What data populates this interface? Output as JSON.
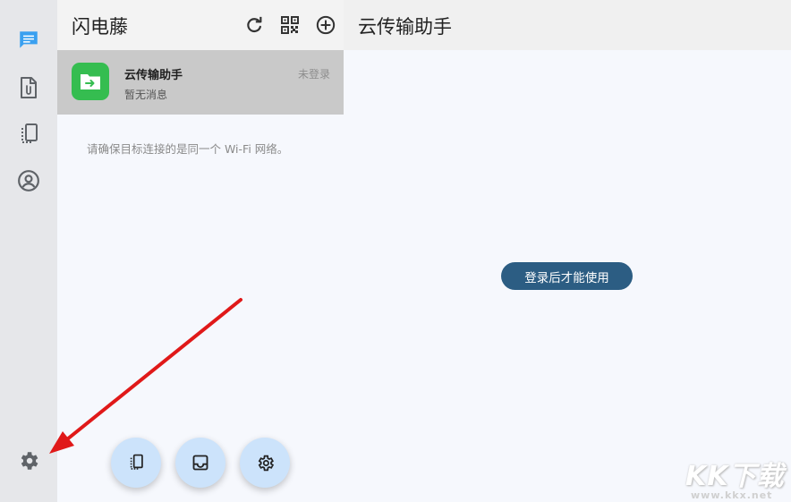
{
  "app": {
    "title": "闪电藤"
  },
  "rail": {
    "items": [
      {
        "name": "messages",
        "icon": "chat-icon",
        "active": true
      },
      {
        "name": "files",
        "icon": "file-attachment-icon",
        "active": false
      },
      {
        "name": "devices",
        "icon": "devices-icon",
        "active": false
      },
      {
        "name": "account",
        "icon": "account-circle-icon",
        "active": false
      }
    ],
    "settings_icon": "gear-icon"
  },
  "header": {
    "title": "闪电藤",
    "actions": [
      {
        "name": "refresh",
        "icon": "refresh-icon"
      },
      {
        "name": "qr-code",
        "icon": "qr-code-icon"
      },
      {
        "name": "add",
        "icon": "add-circle-icon"
      }
    ]
  },
  "conversations": [
    {
      "name": "云传输助手",
      "status": "未登录",
      "preview": "暂无消息",
      "icon": "folder-transfer-icon",
      "selected": true
    }
  ],
  "hint": "请确保目标连接的是同一个 Wi-Fi 网络。",
  "fabs": [
    {
      "name": "devices",
      "icon": "devices-icon"
    },
    {
      "name": "inbox",
      "icon": "inbox-icon"
    },
    {
      "name": "settings",
      "icon": "gear-icon"
    }
  ],
  "main": {
    "title": "云传输助手",
    "login_button": "登录后才能使用"
  },
  "watermark": {
    "logo": "KK下载",
    "url": "www.kkx.net"
  },
  "colors": {
    "rail_bg": "#e6e7ea",
    "selected_row": "#c9c9c9",
    "avatar_green": "#35bd50",
    "login_button": "#2c5d83",
    "fab_bg": "#cce3fb",
    "annotation_arrow": "#e01919",
    "active_icon": "#3aa0f0"
  }
}
